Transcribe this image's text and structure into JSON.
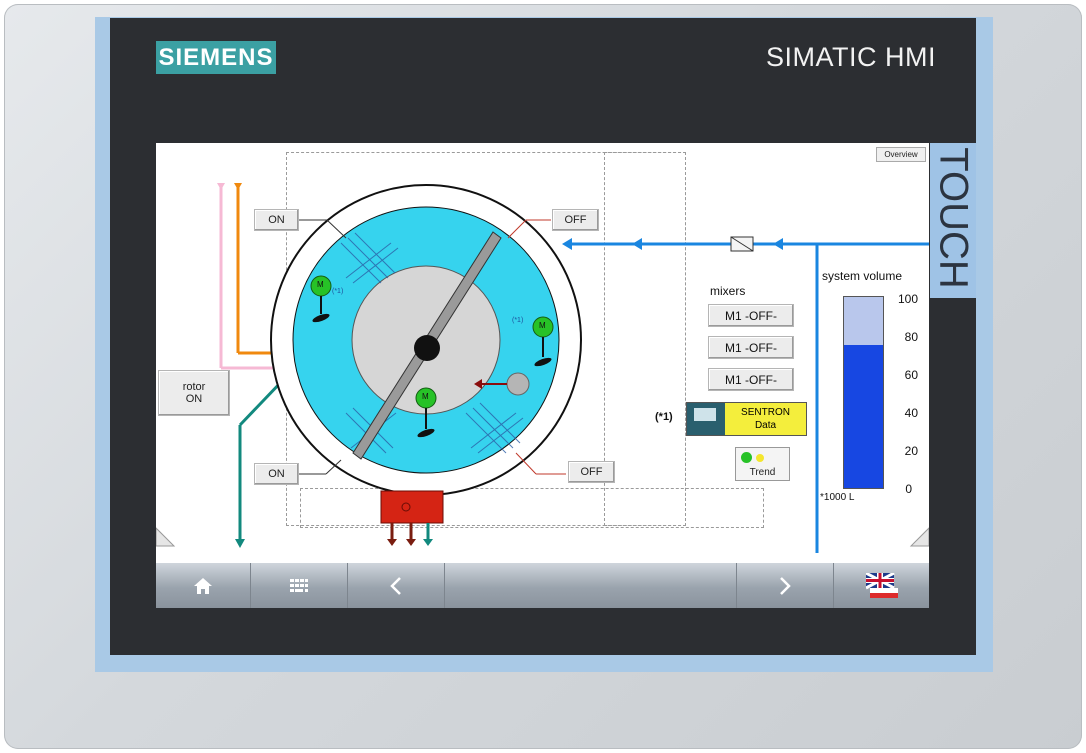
{
  "brand": "SIEMENS",
  "model": "SIMATIC HMI",
  "touch_label": "TOUCH",
  "screen": {
    "overview_button": "Overview",
    "buttons": {
      "on_top": "ON",
      "off_top": "OFF",
      "on_bottom": "ON",
      "off_bottom": "OFF",
      "rotor_line1": "rotor",
      "rotor_line2": "ON"
    },
    "motor_marks": [
      "M",
      "M",
      "M"
    ],
    "motor_notes": [
      "(*1)",
      "(*1)"
    ],
    "mixers": {
      "title": "mixers",
      "items": [
        "M1 -OFF-",
        "M1 -OFF-",
        "M1 -OFF-"
      ]
    },
    "sentron": {
      "note": "(*1)",
      "line1": "SENTRON",
      "line2": "Data"
    },
    "trend_label": "Trend",
    "tank": {
      "title": "system volume",
      "ticks": [
        "100",
        "80",
        "60",
        "40",
        "20",
        "0"
      ],
      "level_percent": 75,
      "unit_note": "*1000 L"
    }
  },
  "navbar": {
    "items": [
      {
        "name": "home-icon",
        "glyph": "⌂"
      },
      {
        "name": "keypad-icon",
        "glyph": "▦"
      },
      {
        "name": "back-icon",
        "glyph": "‹"
      },
      {
        "name": "spacer",
        "glyph": ""
      },
      {
        "name": "forward-icon",
        "glyph": "›"
      },
      {
        "name": "language-flag-icon",
        "glyph": ""
      }
    ]
  },
  "colors": {
    "brand": "#3ba0a3",
    "tank_fill": "#1747e2",
    "mixer_blue": "#36d3ee",
    "pipe_blue": "#1a86e0",
    "motor_green": "#27c227",
    "red": "#d52414"
  }
}
